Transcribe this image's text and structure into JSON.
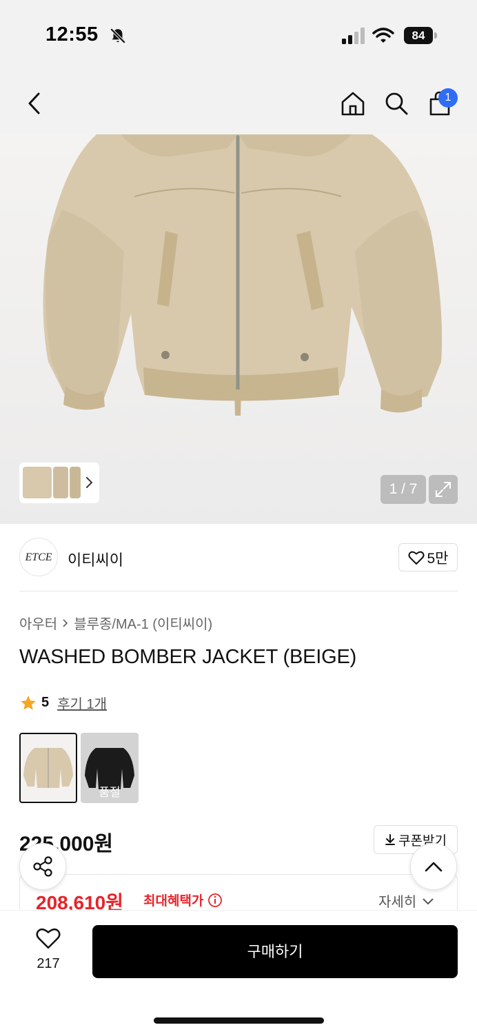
{
  "status_bar": {
    "time": "12:55",
    "battery": "84",
    "icons": [
      "bell-slash-icon",
      "signal-icon",
      "wifi-icon",
      "battery-icon"
    ]
  },
  "nav": {
    "icons": [
      "back-arrow-icon",
      "home-icon",
      "search-icon",
      "shopping-bag-icon"
    ],
    "cart_count": "1"
  },
  "gallery": {
    "counter": "1 / 7",
    "icons": [
      "chevron-right-icon",
      "expand-icon"
    ]
  },
  "brand": {
    "logo_text": "ETCE",
    "name": "이티씨이",
    "like_count": "5만"
  },
  "breadcrumb": {
    "category": "아우터",
    "subcategory": "블루종/MA-1 (이티씨이)"
  },
  "product": {
    "title": "WASHED BOMBER JACKET (BEIGE)",
    "rating": "5",
    "reviews": "후기 1개",
    "variants": [
      {
        "name": "beige",
        "status": ""
      },
      {
        "name": "black",
        "status": "품절"
      }
    ]
  },
  "price": {
    "original": "225,000원",
    "coupon_label": "쿠폰받기",
    "benefit_price": "208,610원",
    "benefit_label": "최대혜택가",
    "detail_label": "자세히"
  },
  "bottom_bar": {
    "wish_count": "217",
    "buy_label": "구매하기"
  },
  "colors": {
    "accent_red": "#e8232a",
    "badge_blue": "#2f6df6",
    "buy_black": "#000000",
    "jacket_beige": "#d8c9ad"
  }
}
